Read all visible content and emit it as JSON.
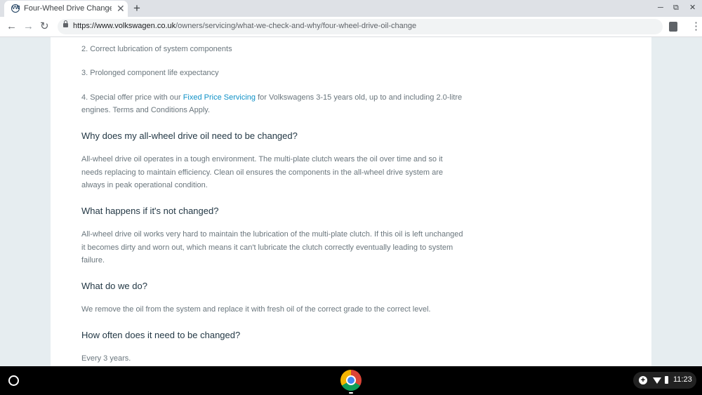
{
  "tab": {
    "title": "Four-Wheel Drive Change | Volkswagen UK",
    "favicon": "VW",
    "close": "✕"
  },
  "window": {
    "new_tab": "+",
    "minimize": "─",
    "restore": "⧉",
    "close": "✕"
  },
  "toolbar": {
    "back": "←",
    "forward": "→",
    "reload": "↻",
    "url_host": "https://www.volkswagen.co.uk",
    "url_path": "/owners/servicing/what-we-check-and-why/four-wheel-drive-oil-change",
    "menu": "⋮"
  },
  "content": {
    "list_item_2": "2.  Correct lubrication of system components",
    "list_item_3": "3.  Prolonged component life expectancy",
    "list_item_4_before": "4.  Special offer price with our ",
    "list_item_4_link": "Fixed Price Servicing",
    "list_item_4_after": " for Volkswagens 3-15 years old, up to and including 2.0-litre engines. Terms and Conditions Apply.",
    "h_why": "Why does my all-wheel drive oil need to be changed?",
    "p_why": "All-wheel drive oil operates in a tough environment. The multi-plate clutch wears the oil over time and so it needs replacing to maintain efficiency. Clean oil ensures the components in the all-wheel drive system are always in peak operational condition.",
    "h_not": "What happens if it's not changed?",
    "p_not": "All-wheel drive oil works very hard to maintain the lubrication of the multi-plate clutch. If this oil is left unchanged it becomes dirty and worn out, which means it can't lubricate the clutch correctly eventually leading to system failure.",
    "h_do": "What do we do?",
    "p_do": "We remove the oil from the system and replace it with fresh oil of the correct grade to the correct level.",
    "h_often": "How often does it need to be changed?",
    "p_often": "Every 3 years."
  },
  "shelf": {
    "add": "+",
    "time": "11:23"
  },
  "colors": {
    "link": "#0f91c7",
    "heading": "#233845",
    "body_text": "#6a767d"
  }
}
